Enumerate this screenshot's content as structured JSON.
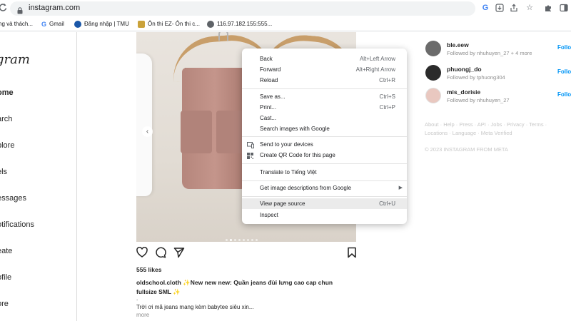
{
  "browser": {
    "url": "instagram.com",
    "bookmarks": [
      {
        "label": "ng và thách...",
        "color": "#e67c22"
      },
      {
        "label": "Gmail",
        "color": "#4285f4"
      },
      {
        "label": "Đăng nhập | TMU",
        "color": "#1a57a8"
      },
      {
        "label": "Ôn thi EZ- Ôn thi c...",
        "color": "#caa23a"
      },
      {
        "label": "116.97.182.155:555...",
        "color": "#5f6368"
      }
    ],
    "toolbar_icons": [
      "google-icon",
      "download-icon",
      "share-icon",
      "star-icon",
      "extensions-icon",
      "sidepanel-icon"
    ]
  },
  "instagram": {
    "logo": "gram",
    "nav": [
      {
        "label": "ome",
        "active": true
      },
      {
        "label": "arch",
        "active": false
      },
      {
        "label": "plore",
        "active": false
      },
      {
        "label": "els",
        "active": false
      },
      {
        "label": "essages",
        "active": false
      },
      {
        "label": "otifications",
        "active": false
      },
      {
        "label": "eate",
        "active": false
      },
      {
        "label": "ofile",
        "active": false
      },
      {
        "label": "ore",
        "active": false
      }
    ],
    "post": {
      "likes": "555 likes",
      "caption_user": "oldschool.cloth",
      "caption_title": "✨New new new: Quần jeans đùi lưng cao cap chun fullsize SML ✨",
      "caption_dot": ".",
      "caption_line": "Trời ơi mã jeans mang kèm babytee siêu xin...",
      "more": "more",
      "slides_total": 8,
      "slide_active": 2
    },
    "suggestions": [
      {
        "name": "ble.eew",
        "sub": "Followed by nhuhuyen_27 + 4 more",
        "follow": "Follow",
        "avatar_color": "#6b6b6b"
      },
      {
        "name": "phuongj_do",
        "sub": "Followed by tphuong304",
        "follow": "Follow",
        "avatar_color": "#2b2b2b"
      },
      {
        "name": "mis_dorisie",
        "sub": "Followed by nhuhuyen_27",
        "follow": "Follow",
        "avatar_color": "#e9c8c0"
      }
    ],
    "footer_links": "About · Help · Press · API · Jobs · Privacy · Terms · Locations · Language · Meta Verified",
    "copyright": "© 2023 INSTAGRAM FROM META"
  },
  "context_menu": {
    "back": {
      "label": "Back",
      "shortcut": "Alt+Left Arrow"
    },
    "forward": {
      "label": "Forward",
      "shortcut": "Alt+Right Arrow"
    },
    "reload": {
      "label": "Reload",
      "shortcut": "Ctrl+R"
    },
    "save_as": {
      "label": "Save as...",
      "shortcut": "Ctrl+S"
    },
    "print": {
      "label": "Print...",
      "shortcut": "Ctrl+P"
    },
    "cast": {
      "label": "Cast..."
    },
    "search_images": {
      "label": "Search images with Google"
    },
    "send_devices": {
      "label": "Send to your devices"
    },
    "qr_code": {
      "label": "Create QR Code for this page"
    },
    "translate": {
      "label": "Translate to Tiếng Việt"
    },
    "image_desc": {
      "label": "Get image descriptions from Google"
    },
    "view_source": {
      "label": "View page source",
      "shortcut": "Ctrl+U"
    },
    "inspect": {
      "label": "Inspect"
    }
  }
}
